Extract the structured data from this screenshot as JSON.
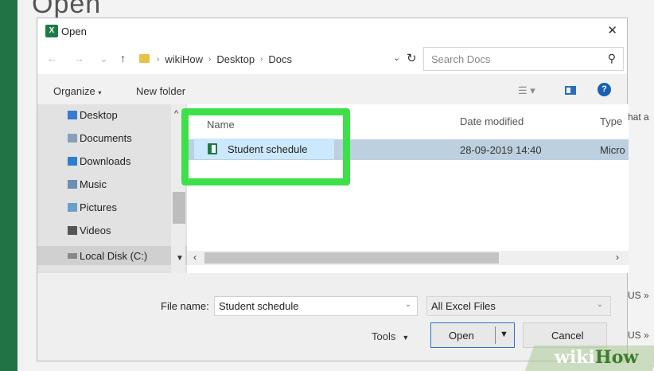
{
  "background": {
    "title_partial": "Open",
    "right_text": "hat a",
    "right_snippets": [
      "US »",
      "US »"
    ]
  },
  "dialog": {
    "title": "Open",
    "close": "✕"
  },
  "navbar": {
    "back": "←",
    "forward": "→",
    "recent": "⌄",
    "up": "↑",
    "crumbs": [
      "wikiHow",
      "Desktop",
      "Docs"
    ],
    "crumb_sep": "›",
    "search_placeholder": "Search Docs"
  },
  "cmdbar": {
    "organize": "Organize",
    "new_folder": "New folder"
  },
  "navpane": {
    "items": [
      {
        "label": "Desktop",
        "icon": "folder-icon",
        "color": "#3a7bd5"
      },
      {
        "label": "Documents",
        "icon": "documents-icon",
        "color": "#8aa0b8"
      },
      {
        "label": "Downloads",
        "icon": "downloads-icon",
        "color": "#2d7fd0"
      },
      {
        "label": "Music",
        "icon": "music-icon",
        "color": "#6b8fb5"
      },
      {
        "label": "Pictures",
        "icon": "pictures-icon",
        "color": "#6aa0c8"
      },
      {
        "label": "Videos",
        "icon": "videos-icon",
        "color": "#555555"
      },
      {
        "label": "Local Disk (C:)",
        "icon": "disk-icon",
        "color": "#888888"
      }
    ]
  },
  "filelist": {
    "columns": [
      "Name",
      "Date modified",
      "Type"
    ],
    "rows": [
      {
        "name": "Student schedule",
        "date": "28-09-2019 14:40",
        "type": "Micro"
      }
    ]
  },
  "bottom": {
    "file_name_label": "File name:",
    "file_name_value": "Student schedule",
    "filter_value": "All Excel Files",
    "tools": "Tools",
    "open": "Open",
    "cancel": "Cancel"
  },
  "watermark": {
    "part1": "wiki",
    "part2": "How"
  },
  "colors": {
    "excel_green": "#217346",
    "highlight": "#3ee04a",
    "selection": "#cce8ff",
    "accent": "#2a73c9"
  }
}
